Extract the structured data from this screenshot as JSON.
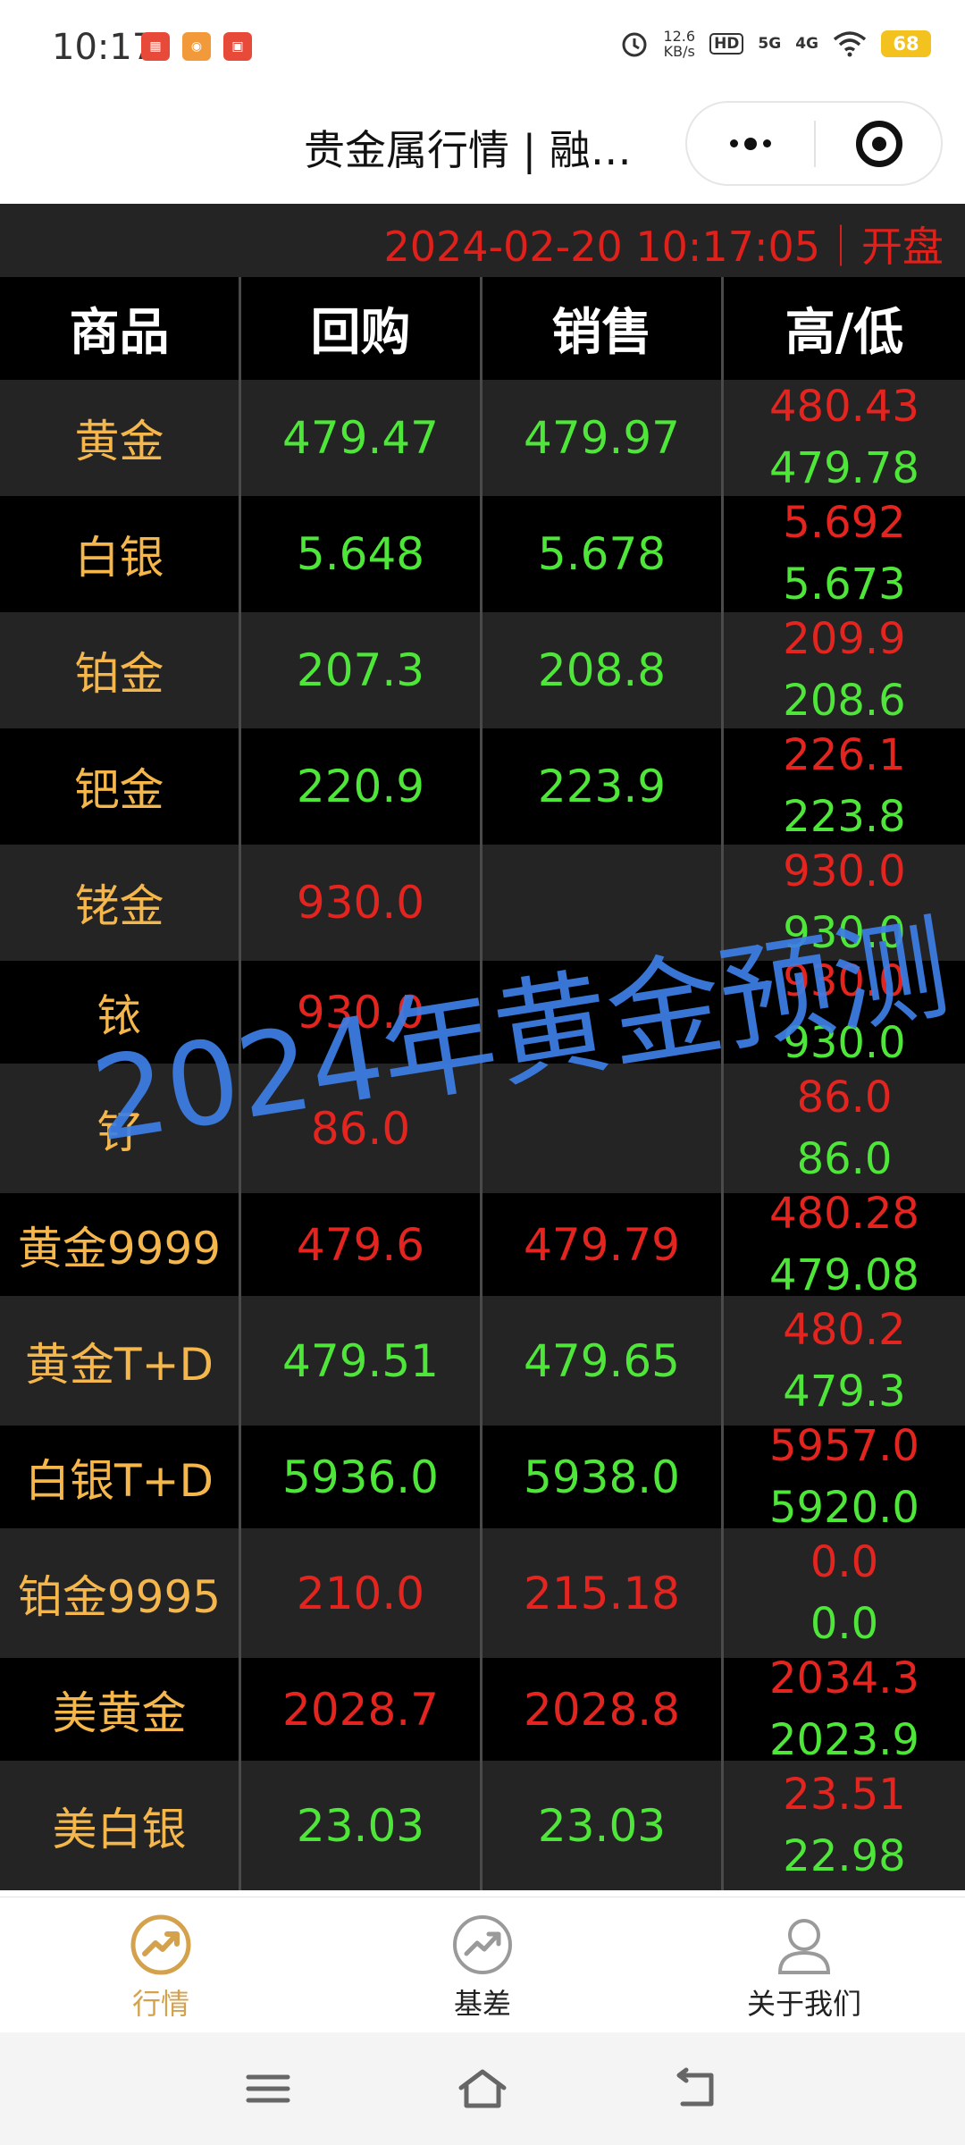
{
  "status_bar": {
    "time": "10:17",
    "app_icons": [
      "app-icon-1",
      "app-icon-2",
      "app-icon-3"
    ],
    "net_speed_value": "12.6",
    "net_speed_unit": "KB/s",
    "hd_label": "HD",
    "net_5g": "5G",
    "net_4g": "4G",
    "battery": "68"
  },
  "title_bar": {
    "title": "贵金属行情 | 融…"
  },
  "timestamp_bar": {
    "text": "2024-02-20 10:17:05｜开盘"
  },
  "table": {
    "headers": [
      "商品",
      "回购",
      "销售",
      "高/低"
    ],
    "rows": [
      {
        "name": "黄金",
        "buy": "479.47",
        "sell": "479.97",
        "high": "480.43",
        "low": "479.78",
        "color": "green"
      },
      {
        "name": "白银",
        "buy": "5.648",
        "sell": "5.678",
        "high": "5.692",
        "low": "5.673",
        "color": "green"
      },
      {
        "name": "铂金",
        "buy": "207.3",
        "sell": "208.8",
        "high": "209.9",
        "low": "208.6",
        "color": "green"
      },
      {
        "name": "钯金",
        "buy": "220.9",
        "sell": "223.9",
        "high": "226.1",
        "low": "223.8",
        "color": "green"
      },
      {
        "name": "铑金",
        "buy": "930.0",
        "sell": "",
        "high": "930.0",
        "low": "930.0",
        "color": "red"
      },
      {
        "name": "铱",
        "buy": "930.0",
        "sell": "",
        "high": "930.0",
        "low": "930.0",
        "color": "red"
      },
      {
        "name": "钌",
        "buy": "86.0",
        "sell": "",
        "high": "86.0",
        "low": "86.0",
        "color": "red"
      },
      {
        "name": "黄金9999",
        "buy": "479.6",
        "sell": "479.79",
        "high": "480.28",
        "low": "479.08",
        "color": "red"
      },
      {
        "name": "黄金T+D",
        "buy": "479.51",
        "sell": "479.65",
        "high": "480.2",
        "low": "479.3",
        "color": "green"
      },
      {
        "name": "白银T+D",
        "buy": "5936.0",
        "sell": "5938.0",
        "high": "5957.0",
        "low": "5920.0",
        "color": "green"
      },
      {
        "name": "铂金9995",
        "buy": "210.0",
        "sell": "215.18",
        "high": "0.0",
        "low": "0.0",
        "color": "red"
      },
      {
        "name": "美黄金",
        "buy": "2028.7",
        "sell": "2028.8",
        "high": "2034.3",
        "low": "2023.9",
        "color": "red"
      },
      {
        "name": "美白银",
        "buy": "23.03",
        "sell": "23.03",
        "high": "23.51",
        "low": "22.98",
        "color": "green"
      }
    ]
  },
  "watermark": "2024年黄金预测",
  "tabs": [
    {
      "label": "行情",
      "icon": "trend-chart-icon",
      "active": true
    },
    {
      "label": "基差",
      "icon": "trend-chart-icon",
      "active": false
    },
    {
      "label": "关于我们",
      "icon": "user-icon",
      "active": false
    }
  ],
  "colors": {
    "header_bg": "#000000",
    "row_grey": "#242424",
    "name_gold": "#f5b74b",
    "price_red": "#e4241f",
    "price_green": "#4fe63a",
    "watermark_blue": "#3d7fe6",
    "tab_active": "#d4a24c"
  }
}
